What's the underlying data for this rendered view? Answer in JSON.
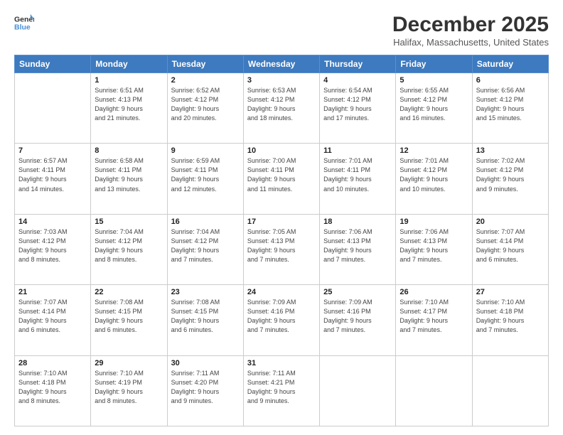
{
  "logo": {
    "line1": "General",
    "line2": "Blue"
  },
  "header": {
    "month_year": "December 2025",
    "location": "Halifax, Massachusetts, United States"
  },
  "days_of_week": [
    "Sunday",
    "Monday",
    "Tuesday",
    "Wednesday",
    "Thursday",
    "Friday",
    "Saturday"
  ],
  "weeks": [
    [
      {
        "day": "",
        "info": ""
      },
      {
        "day": "1",
        "info": "Sunrise: 6:51 AM\nSunset: 4:13 PM\nDaylight: 9 hours\nand 21 minutes."
      },
      {
        "day": "2",
        "info": "Sunrise: 6:52 AM\nSunset: 4:12 PM\nDaylight: 9 hours\nand 20 minutes."
      },
      {
        "day": "3",
        "info": "Sunrise: 6:53 AM\nSunset: 4:12 PM\nDaylight: 9 hours\nand 18 minutes."
      },
      {
        "day": "4",
        "info": "Sunrise: 6:54 AM\nSunset: 4:12 PM\nDaylight: 9 hours\nand 17 minutes."
      },
      {
        "day": "5",
        "info": "Sunrise: 6:55 AM\nSunset: 4:12 PM\nDaylight: 9 hours\nand 16 minutes."
      },
      {
        "day": "6",
        "info": "Sunrise: 6:56 AM\nSunset: 4:12 PM\nDaylight: 9 hours\nand 15 minutes."
      }
    ],
    [
      {
        "day": "7",
        "info": "Sunrise: 6:57 AM\nSunset: 4:11 PM\nDaylight: 9 hours\nand 14 minutes."
      },
      {
        "day": "8",
        "info": "Sunrise: 6:58 AM\nSunset: 4:11 PM\nDaylight: 9 hours\nand 13 minutes."
      },
      {
        "day": "9",
        "info": "Sunrise: 6:59 AM\nSunset: 4:11 PM\nDaylight: 9 hours\nand 12 minutes."
      },
      {
        "day": "10",
        "info": "Sunrise: 7:00 AM\nSunset: 4:11 PM\nDaylight: 9 hours\nand 11 minutes."
      },
      {
        "day": "11",
        "info": "Sunrise: 7:01 AM\nSunset: 4:11 PM\nDaylight: 9 hours\nand 10 minutes."
      },
      {
        "day": "12",
        "info": "Sunrise: 7:01 AM\nSunset: 4:12 PM\nDaylight: 9 hours\nand 10 minutes."
      },
      {
        "day": "13",
        "info": "Sunrise: 7:02 AM\nSunset: 4:12 PM\nDaylight: 9 hours\nand 9 minutes."
      }
    ],
    [
      {
        "day": "14",
        "info": "Sunrise: 7:03 AM\nSunset: 4:12 PM\nDaylight: 9 hours\nand 8 minutes."
      },
      {
        "day": "15",
        "info": "Sunrise: 7:04 AM\nSunset: 4:12 PM\nDaylight: 9 hours\nand 8 minutes."
      },
      {
        "day": "16",
        "info": "Sunrise: 7:04 AM\nSunset: 4:12 PM\nDaylight: 9 hours\nand 7 minutes."
      },
      {
        "day": "17",
        "info": "Sunrise: 7:05 AM\nSunset: 4:13 PM\nDaylight: 9 hours\nand 7 minutes."
      },
      {
        "day": "18",
        "info": "Sunrise: 7:06 AM\nSunset: 4:13 PM\nDaylight: 9 hours\nand 7 minutes."
      },
      {
        "day": "19",
        "info": "Sunrise: 7:06 AM\nSunset: 4:13 PM\nDaylight: 9 hours\nand 7 minutes."
      },
      {
        "day": "20",
        "info": "Sunrise: 7:07 AM\nSunset: 4:14 PM\nDaylight: 9 hours\nand 6 minutes."
      }
    ],
    [
      {
        "day": "21",
        "info": "Sunrise: 7:07 AM\nSunset: 4:14 PM\nDaylight: 9 hours\nand 6 minutes."
      },
      {
        "day": "22",
        "info": "Sunrise: 7:08 AM\nSunset: 4:15 PM\nDaylight: 9 hours\nand 6 minutes."
      },
      {
        "day": "23",
        "info": "Sunrise: 7:08 AM\nSunset: 4:15 PM\nDaylight: 9 hours\nand 6 minutes."
      },
      {
        "day": "24",
        "info": "Sunrise: 7:09 AM\nSunset: 4:16 PM\nDaylight: 9 hours\nand 7 minutes."
      },
      {
        "day": "25",
        "info": "Sunrise: 7:09 AM\nSunset: 4:16 PM\nDaylight: 9 hours\nand 7 minutes."
      },
      {
        "day": "26",
        "info": "Sunrise: 7:10 AM\nSunset: 4:17 PM\nDaylight: 9 hours\nand 7 minutes."
      },
      {
        "day": "27",
        "info": "Sunrise: 7:10 AM\nSunset: 4:18 PM\nDaylight: 9 hours\nand 7 minutes."
      }
    ],
    [
      {
        "day": "28",
        "info": "Sunrise: 7:10 AM\nSunset: 4:18 PM\nDaylight: 9 hours\nand 8 minutes."
      },
      {
        "day": "29",
        "info": "Sunrise: 7:10 AM\nSunset: 4:19 PM\nDaylight: 9 hours\nand 8 minutes."
      },
      {
        "day": "30",
        "info": "Sunrise: 7:11 AM\nSunset: 4:20 PM\nDaylight: 9 hours\nand 9 minutes."
      },
      {
        "day": "31",
        "info": "Sunrise: 7:11 AM\nSunset: 4:21 PM\nDaylight: 9 hours\nand 9 minutes."
      },
      {
        "day": "",
        "info": ""
      },
      {
        "day": "",
        "info": ""
      },
      {
        "day": "",
        "info": ""
      }
    ]
  ]
}
